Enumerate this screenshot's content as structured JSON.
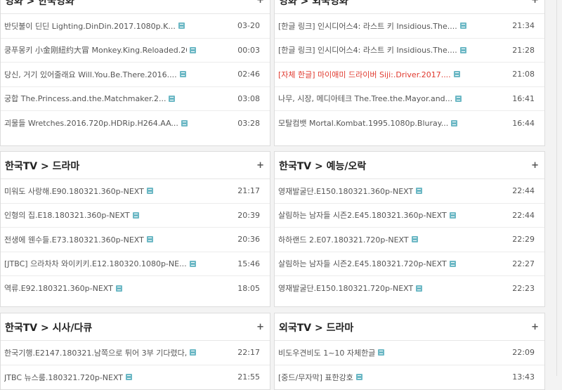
{
  "panels": [
    {
      "title": "영화 > 한국영화",
      "rows": [
        {
          "title": "반딧불이 딘딘 Lighting.DinDin.2017.1080p.K...",
          "time": "03-20",
          "red": false
        },
        {
          "title": "쿵푸몽키 小金刚紐约大冒 Monkey.King.Reloaded.20...",
          "time": "00:03",
          "red": false
        },
        {
          "title": "당신, 거기 있어줄래요 Will.You.Be.There.2016....",
          "time": "02:46",
          "red": false
        },
        {
          "title": "궁합 The.Princess.and.the.Matchmaker.2...",
          "time": "03:08",
          "red": false
        },
        {
          "title": "괴물들 Wretches.2016.720p.HDRip.H264.AA...",
          "time": "03:28",
          "red": false
        }
      ]
    },
    {
      "title": "영화 > 외국영화",
      "rows": [
        {
          "title": "[한글 링크] 인시디어스4: 라스트 키 Insidious.The....",
          "time": "21:34",
          "red": false
        },
        {
          "title": "[한글 링크] 인시디어스4: 라스트 키 Insidious.The....",
          "time": "21:28",
          "red": false
        },
        {
          "title": "[자체 한글] 마이애미 드라이버 Siji:.Driver.2017....",
          "time": "21:08",
          "red": true
        },
        {
          "title": "나무, 시장, 메디아테크 The.Tree.the.Mayor.and...",
          "time": "16:41",
          "red": false
        },
        {
          "title": "모탈컴뱃 Mortal.Kombat.1995.1080p.Bluray...",
          "time": "16:44",
          "red": false
        }
      ]
    },
    {
      "title": "한국TV > 드라마",
      "rows": [
        {
          "title": "미워도 사랑해.E90.180321.360p-NEXT",
          "time": "21:17",
          "red": false
        },
        {
          "title": "인형의 집.E18.180321.360p-NEXT",
          "time": "20:39",
          "red": false
        },
        {
          "title": "전생에 웬수들.E73.180321.360p-NEXT",
          "time": "20:36",
          "red": false
        },
        {
          "title": "[JTBC] 으라차차 와이키키.E12.180320.1080p-NE...",
          "time": "15:46",
          "red": false
        },
        {
          "title": "역류.E92.180321.360p-NEXT",
          "time": "18:05",
          "red": false
        }
      ]
    },
    {
      "title": "한국TV > 예능/오락",
      "rows": [
        {
          "title": "영재발굴단.E150.180321.360p-NEXT",
          "time": "22:44",
          "red": false
        },
        {
          "title": "살림하는 남자들 시즌2.E45.180321.360p-NEXT",
          "time": "22:44",
          "red": false
        },
        {
          "title": "하하랜드 2.E07.180321.720p-NEXT",
          "time": "22:29",
          "red": false
        },
        {
          "title": "살림하는 남자들 시즌2.E45.180321.720p-NEXT",
          "time": "22:27",
          "red": false
        },
        {
          "title": "영재발굴단.E150.180321.720p-NEXT",
          "time": "22:23",
          "red": false
        }
      ]
    },
    {
      "title": "한국TV > 시사/다큐",
      "rows": [
        {
          "title": "한국기행.E2147.180321.남쪽으로 튀어 3부 기다렸다, 봄...",
          "time": "22:17",
          "red": false
        },
        {
          "title": "JTBC 뉴스룸.180321.720p-NEXT",
          "time": "21:55",
          "red": false
        }
      ]
    },
    {
      "title": "외국TV > 드라마",
      "rows": [
        {
          "title": "비도우견비도 1~10 자체한글",
          "time": "22:09",
          "red": false
        },
        {
          "title": "[중드/무자막] 표한강호",
          "time": "13:43",
          "red": false
        }
      ]
    }
  ]
}
